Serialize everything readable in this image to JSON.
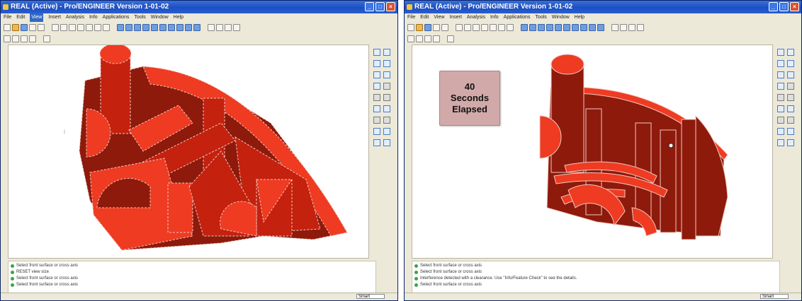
{
  "left_window": {
    "title": "REAL (Active) - Pro/ENGINEER Version 1-01-02",
    "menu": [
      "File",
      "Edit",
      "View",
      "Insert",
      "Analysis",
      "Info",
      "Applications",
      "Tools",
      "Window",
      "Help"
    ],
    "active_menu": "View",
    "messages": [
      "Select front surface or cross axis",
      "RESET view size",
      "Select front surface or cross axis",
      "Select front surface or cross axis"
    ],
    "filter": "Smart"
  },
  "right_window": {
    "title": "REAL (Active) - Pro/ENGINEER Version 1-01-02",
    "menu": [
      "File",
      "Edit",
      "View",
      "Insert",
      "Analysis",
      "Info",
      "Applications",
      "Tools",
      "Window",
      "Help"
    ],
    "timer": {
      "value": "40",
      "line1": "Seconds",
      "line2": "Elapsed"
    },
    "messages": [
      "Select front surface or cross axis",
      "Select front surface or cross axis",
      "Interference detected with a clearance. Use \"Info/Feature Check\" to see the details.",
      "Select front surface or cross axis"
    ],
    "filter": "Smart"
  },
  "colors": {
    "part_dark": "#8e1a0c",
    "part_mid": "#c4210e",
    "part_light": "#ee3b22",
    "edge": "#f0c8c0"
  }
}
